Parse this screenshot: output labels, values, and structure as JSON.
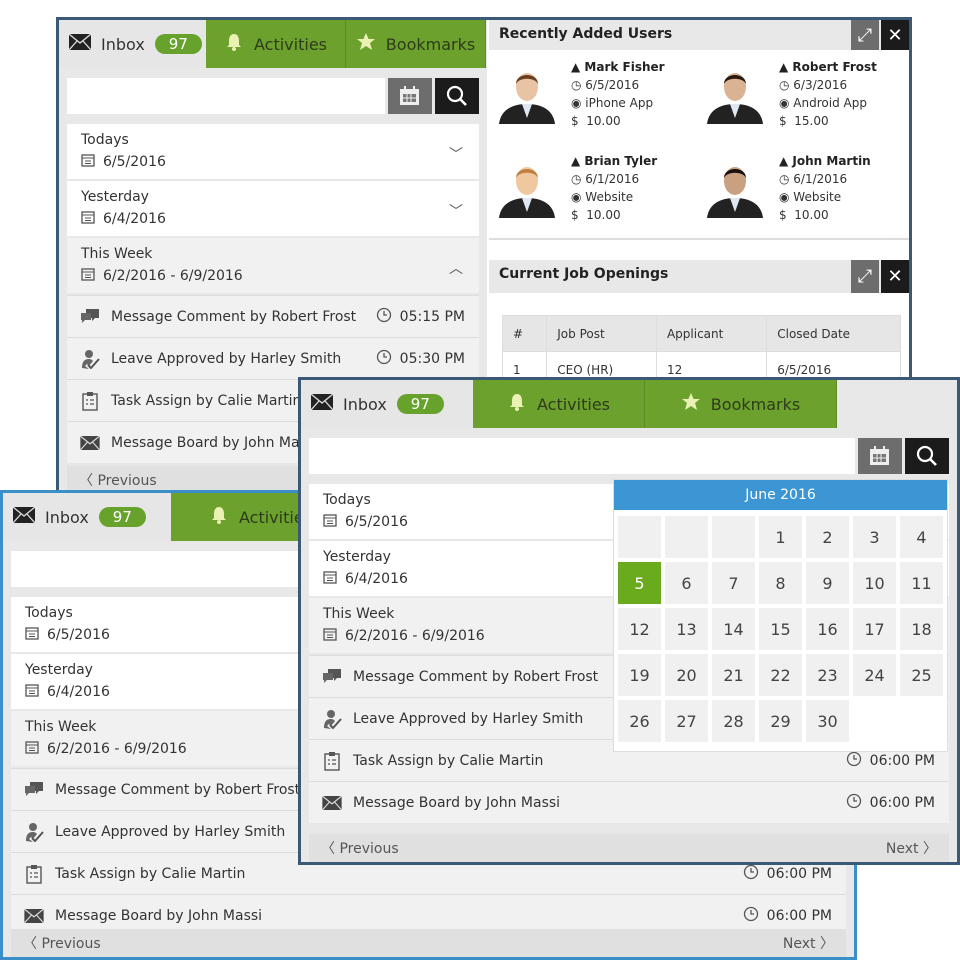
{
  "colors": {
    "accent_green": "#6da12e",
    "badge_green": "#67a22c",
    "calendar_blue": "#3b96d3",
    "selected_day": "#6aab1e",
    "frame_dark": "#3c5877",
    "frame_light": "#3a8fc9"
  },
  "panels": {
    "back": {
      "tabs": {
        "inbox": "Inbox",
        "badge": "97",
        "activities": "Activities",
        "bookmarks": "Bookmarks"
      },
      "groups": [
        {
          "label": "Todays",
          "date": "6/5/2016",
          "chevron": "chevron-down"
        },
        {
          "label": "Yesterday",
          "date": "6/4/2016",
          "chevron": "chevron-down"
        },
        {
          "label": "This Week",
          "date": "6/2/2016 - 6/9/2016",
          "chevron": "chevron-up"
        }
      ],
      "items": [
        {
          "icon": "comment",
          "text": "Message Comment by Robert Frost",
          "time": "05:15 PM"
        },
        {
          "icon": "approve",
          "text": "Leave Approved by Harley Smith",
          "time": "05:30 PM"
        },
        {
          "icon": "clipboard",
          "text": "Task Assign by Calie Martin",
          "time": ""
        },
        {
          "icon": "mail",
          "text": "Message Board by John Massi",
          "time": ""
        }
      ],
      "footer": {
        "previous": "Previous",
        "next": ""
      }
    },
    "left": {
      "tabs": {
        "inbox": "Inbox",
        "badge": "97",
        "activities": "Activities",
        "bookmarks": ""
      },
      "groups": [
        {
          "label": "Todays",
          "date": "6/5/2016"
        },
        {
          "label": "Yesterday",
          "date": "6/4/2016"
        },
        {
          "label": "This Week",
          "date": "6/2/2016 - 6/9/2016"
        }
      ],
      "items": [
        {
          "icon": "comment",
          "text": "Message Comment by Robert Frost",
          "time": ""
        },
        {
          "icon": "approve",
          "text": "Leave Approved by Harley Smith",
          "time": ""
        },
        {
          "icon": "clipboard",
          "text": "Task Assign by Calie Martin",
          "time": "06:00 PM"
        },
        {
          "icon": "mail",
          "text": "Message Board by John Massi",
          "time": "06:00 PM"
        }
      ],
      "footer": {
        "previous": "Previous",
        "next": "Next"
      }
    },
    "front": {
      "tabs": {
        "inbox": "Inbox",
        "badge": "97",
        "activities": "Activities",
        "bookmarks": "Bookmarks"
      },
      "groups": [
        {
          "label": "Todays",
          "date": "6/5/2016"
        },
        {
          "label": "Yesterday",
          "date": "6/4/2016"
        },
        {
          "label": "This Week",
          "date": "6/2/2016 - 6/9/2016"
        }
      ],
      "items": [
        {
          "icon": "comment",
          "text": "Message Comment by Robert Frost",
          "time": ""
        },
        {
          "icon": "approve",
          "text": "Leave Approved by Harley Smith",
          "time": ""
        },
        {
          "icon": "clipboard",
          "text": "Task Assign by Calie Martin",
          "time": "06:00 PM"
        },
        {
          "icon": "mail",
          "text": "Message Board by John Massi",
          "time": "06:00 PM"
        }
      ],
      "footer": {
        "previous": "Previous",
        "next": "Next"
      }
    }
  },
  "recent_users": {
    "title": "Recently Added Users",
    "users": [
      {
        "name": "Mark Fisher",
        "date": "6/5/2016",
        "source": "iPhone App",
        "amount": "10.00"
      },
      {
        "name": "Robert Frost",
        "date": "6/3/2016",
        "source": "Android App",
        "amount": "15.00"
      },
      {
        "name": "Brian Tyler",
        "date": "6/1/2016",
        "source": "Website",
        "amount": "10.00"
      },
      {
        "name": "John Martin",
        "date": "6/1/2016",
        "source": "Website",
        "amount": "10.00"
      }
    ],
    "currency": "$"
  },
  "jobs": {
    "title": "Current Job Openings",
    "columns": [
      "#",
      "Job Post",
      "Applicant",
      "Closed Date"
    ],
    "rows": [
      [
        "1",
        "CEO (HR)",
        "12",
        "6/5/2016"
      ]
    ]
  },
  "calendar": {
    "title": "June 2016",
    "leading_blanks": 3,
    "days": 30,
    "selected": 5
  }
}
